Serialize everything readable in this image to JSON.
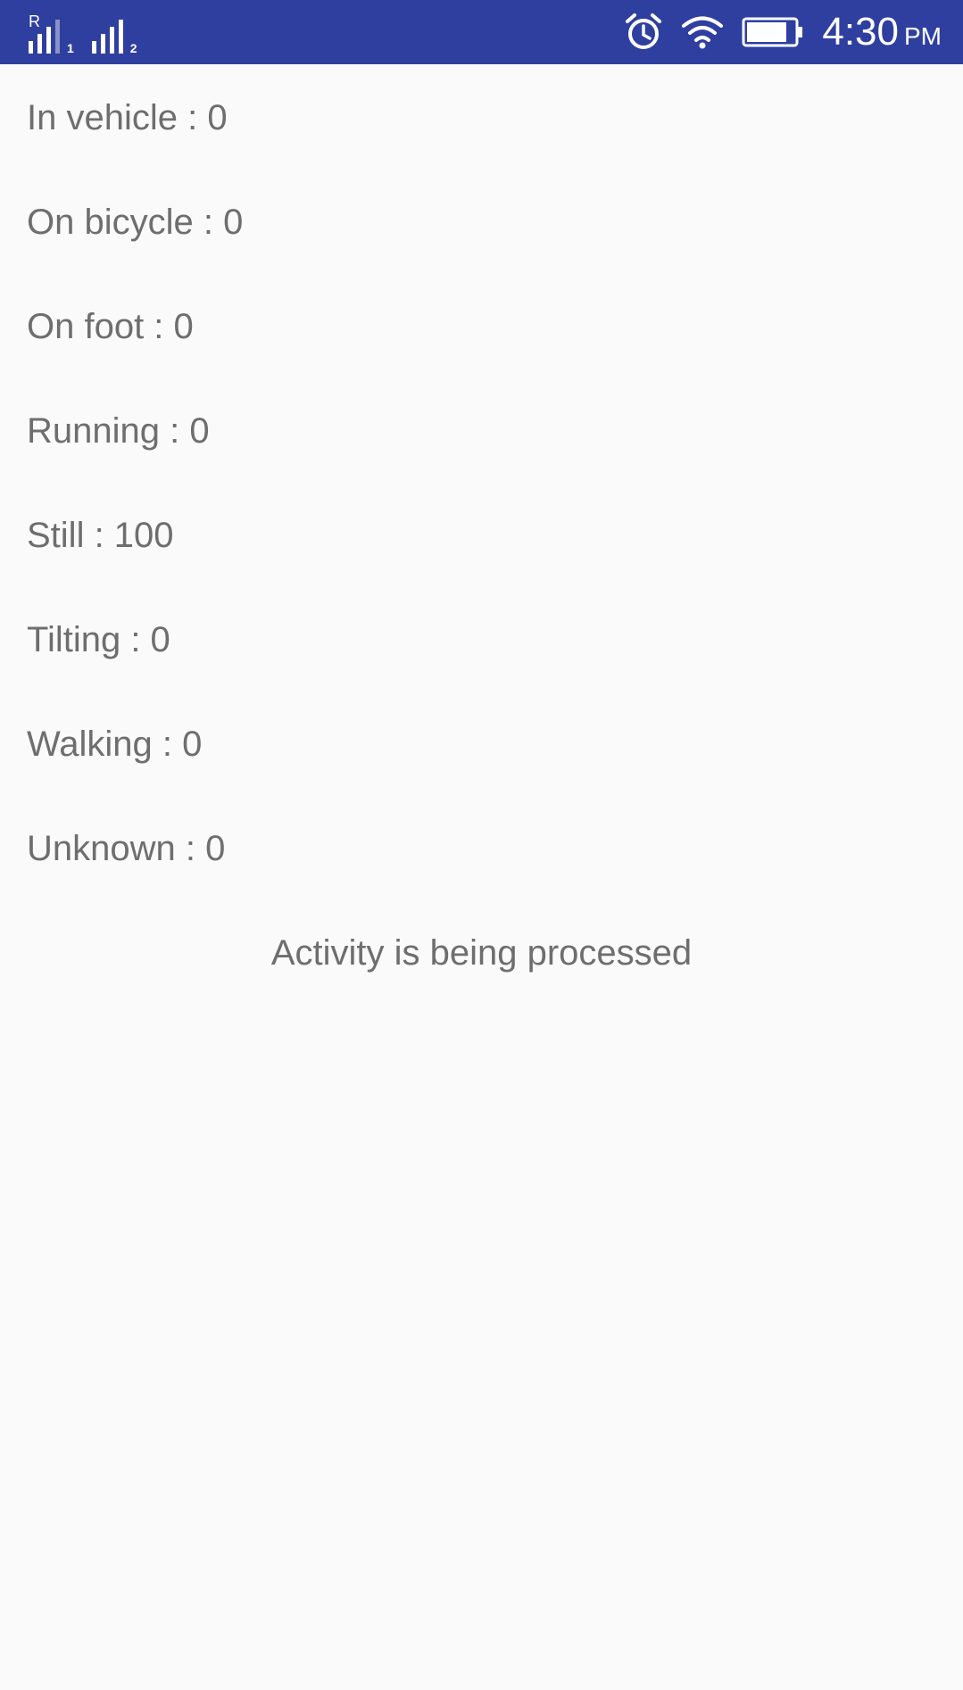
{
  "status_bar": {
    "sim1_label": "1",
    "sim2_label": "2",
    "roaming_indicator": "R",
    "time": "4:30",
    "ampm": "PM",
    "icons": [
      "signal-icon",
      "signal-icon",
      "alarm-icon",
      "wifi-icon",
      "battery-icon"
    ],
    "background_color": "#2f3f9f"
  },
  "activities": [
    {
      "label": "In vehicle : 0"
    },
    {
      "label": "On bicycle : 0"
    },
    {
      "label": "On foot : 0"
    },
    {
      "label": "Running : 0"
    },
    {
      "label": "Still : 100"
    },
    {
      "label": "Tilting : 0"
    },
    {
      "label": "Walking : 0"
    },
    {
      "label": "Unknown : 0"
    }
  ],
  "status_message": "Activity is being processed",
  "text_color": "#6e6e6e",
  "background_color": "#fafafa"
}
